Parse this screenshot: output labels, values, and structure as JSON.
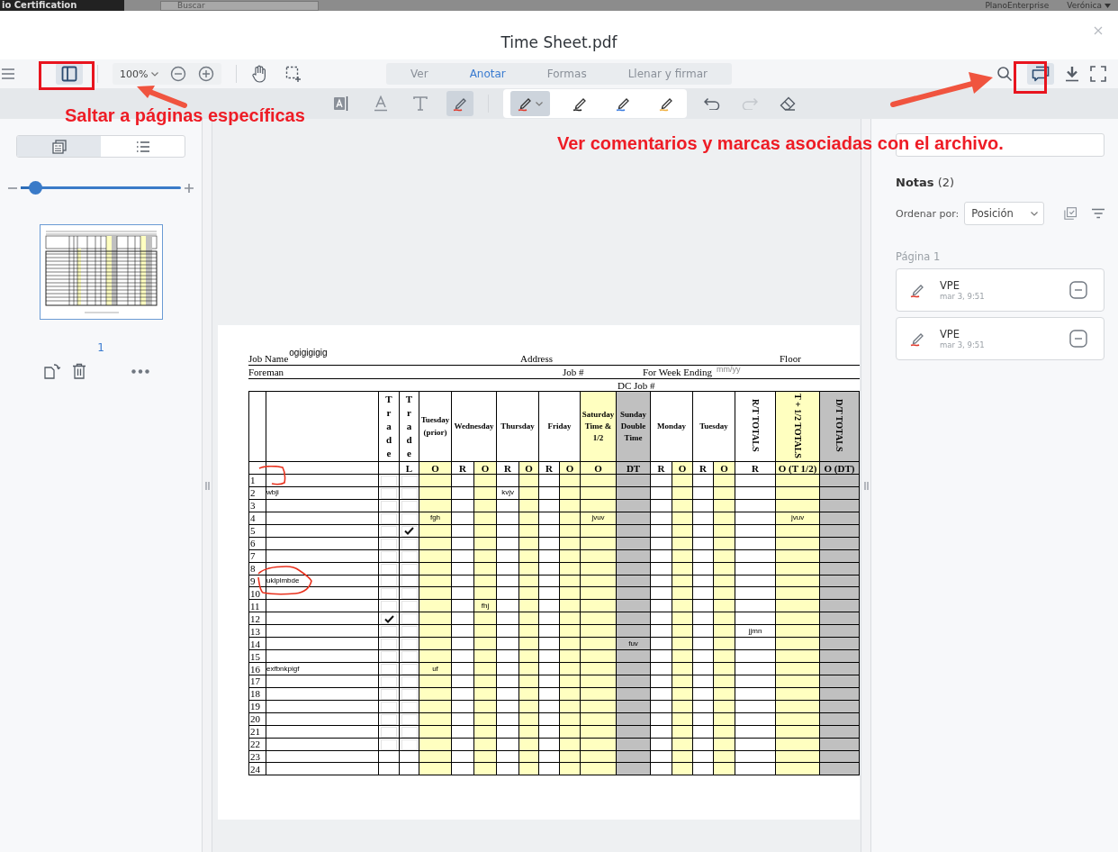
{
  "app_bar": {
    "workspace": "io Certification",
    "search_placeholder": "Buscar",
    "org": "PlanoEnterprise",
    "user": "Verónica"
  },
  "document": {
    "title": "Time Sheet.pdf"
  },
  "toolbar": {
    "panel_toggle_selected": true,
    "zoom": "100%",
    "modes": [
      {
        "label": "Ver",
        "selected": false
      },
      {
        "label": "Anotar",
        "selected": true
      },
      {
        "label": "Formas",
        "selected": false
      },
      {
        "label": "Llenar y firmar",
        "selected": false
      }
    ],
    "comments_selected": true
  },
  "annotate_tools": {
    "tools": [
      {
        "kind": "text-select",
        "selected": false
      },
      {
        "kind": "underline",
        "selected": false
      },
      {
        "kind": "text",
        "selected": false
      },
      {
        "kind": "highlight",
        "selected": true
      }
    ],
    "pens": [
      {
        "color": "#e0392b",
        "selected": true
      },
      {
        "color": "#222222",
        "selected": false
      },
      {
        "color": "#3a7be0",
        "selected": false
      },
      {
        "color": "#f0b040",
        "selected": false
      }
    ],
    "redo_disabled": true
  },
  "callouts": [
    {
      "text": "Saltar a páginas específicas"
    },
    {
      "text": "Ver comentarios y marcas asociadas con el archivo."
    }
  ],
  "left_panel": {
    "views": [
      {
        "kind": "thumbnails",
        "selected": true
      },
      {
        "kind": "outline",
        "selected": false
      }
    ],
    "thumb_size": {
      "level": 0.09
    },
    "pages": [
      {
        "number": "1",
        "selected": true
      }
    ]
  },
  "notes_panel": {
    "title": "Notas",
    "count": "(2)",
    "sort_label": "Ordenar por:",
    "sort_value": "Posición",
    "groups": [
      {
        "label": "Página 1",
        "notes": [
          {
            "author": "VPE",
            "time": "mar 3, 9:51"
          },
          {
            "author": "VPE",
            "time": "mar 3, 9:51"
          }
        ]
      }
    ]
  },
  "sheet": {
    "job_name_label": "Job Name",
    "job_name": "ogigigigig",
    "address_label": "Address",
    "floor_label": "Floor",
    "foreman_label": "Foreman",
    "job_no_label": "Job #",
    "week_ending_label": "For Week Ending",
    "week_ending_hint": "mm/yy",
    "dc_job_label": "DC Job #",
    "trade_columns": [
      {
        "label": "Trade"
      },
      {
        "label": "Trade",
        "sub": "L"
      }
    ],
    "day_columns": [
      {
        "label": "Tuesday (prior)",
        "kind": "plain",
        "color": "#ffffff",
        "subs": [
          {
            "label": "O",
            "color": "#ffffc0"
          }
        ]
      },
      {
        "label": "Wednesday",
        "kind": "plain",
        "color": "#ffffff",
        "subs": [
          {
            "label": "R",
            "color": "#ffffff"
          },
          {
            "label": "O",
            "color": "#ffffc0"
          }
        ]
      },
      {
        "label": "Thursday",
        "kind": "plain",
        "color": "#ffffff",
        "subs": [
          {
            "label": "R",
            "color": "#ffffff"
          },
          {
            "label": "O",
            "color": "#ffffc0"
          }
        ]
      },
      {
        "label": "Friday",
        "kind": "plain",
        "color": "#ffffff",
        "subs": [
          {
            "label": "R",
            "color": "#ffffff"
          },
          {
            "label": "O",
            "color": "#ffffc0"
          }
        ]
      },
      {
        "label": "Saturday Time & 1/2",
        "kind": "plain",
        "color": "#ffffc0",
        "subs": [
          {
            "label": "O",
            "color": "#ffffc0"
          }
        ]
      },
      {
        "label": "Sunday Double Time",
        "kind": "plain",
        "color": "#c0c0c0",
        "subs": [
          {
            "label": "DT",
            "color": "#c0c0c0"
          }
        ]
      },
      {
        "label": "Monday",
        "kind": "plain",
        "color": "#ffffff",
        "subs": [
          {
            "label": "R",
            "color": "#ffffff"
          },
          {
            "label": "O",
            "color": "#ffffc0"
          }
        ]
      },
      {
        "label": "Tuesday",
        "kind": "plain",
        "color": "#ffffff",
        "subs": [
          {
            "label": "R",
            "color": "#ffffff"
          },
          {
            "label": "O",
            "color": "#ffffc0"
          }
        ]
      },
      {
        "label": "R/T TOTALS",
        "kind": "rotated",
        "color": "#ffffff",
        "subs": [
          {
            "label": "R",
            "color": "#ffffff"
          }
        ]
      },
      {
        "label": "T + 1/2 TOTALS",
        "kind": "rotated",
        "color": "#ffffc0",
        "subs": [
          {
            "label": "O (T 1/2)",
            "color": "#ffffc0"
          }
        ]
      },
      {
        "label": "D/T TOTALS",
        "kind": "rotated",
        "color": "#c0c0c0",
        "subs": [
          {
            "label": "O (DT)",
            "color": "#c0c0c0"
          }
        ]
      }
    ],
    "rows": [
      {
        "number": "1",
        "trade_checks": [
          false,
          false
        ],
        "cells": [
          null,
          null,
          null,
          null,
          null,
          null,
          null,
          null,
          null,
          null,
          null,
          null,
          null,
          null,
          null,
          null
        ]
      },
      {
        "number": "2",
        "name": "wbji",
        "trade_checks": [
          false,
          false
        ],
        "cells": [
          null,
          null,
          null,
          "kvjv",
          null,
          null,
          null,
          null,
          null,
          null,
          null,
          null,
          null,
          null,
          null,
          null
        ]
      },
      {
        "number": "3",
        "trade_checks": [
          false,
          false
        ],
        "cells": [
          null,
          null,
          null,
          null,
          null,
          null,
          null,
          null,
          null,
          null,
          null,
          null,
          null,
          null,
          null,
          null
        ]
      },
      {
        "number": "4",
        "trade_checks": [
          false,
          false
        ],
        "cells": [
          "fgh",
          null,
          null,
          null,
          null,
          null,
          null,
          "jvuv",
          null,
          null,
          null,
          null,
          null,
          null,
          "jvuv",
          null
        ]
      },
      {
        "number": "5",
        "trade_checks": [
          false,
          true
        ],
        "cells": [
          null,
          null,
          null,
          null,
          null,
          null,
          null,
          null,
          null,
          null,
          null,
          null,
          null,
          null,
          null,
          null
        ]
      },
      {
        "number": "6",
        "trade_checks": [
          false,
          false
        ],
        "cells": [
          null,
          null,
          null,
          null,
          null,
          null,
          null,
          null,
          null,
          null,
          null,
          null,
          null,
          null,
          null,
          null
        ]
      },
      {
        "number": "7",
        "trade_checks": [
          false,
          false
        ],
        "cells": [
          null,
          null,
          null,
          null,
          null,
          null,
          null,
          null,
          null,
          null,
          null,
          null,
          null,
          null,
          null,
          null
        ]
      },
      {
        "number": "8",
        "trade_checks": [
          false,
          false
        ],
        "cells": [
          null,
          null,
          null,
          null,
          null,
          null,
          null,
          null,
          null,
          null,
          null,
          null,
          null,
          null,
          null,
          null
        ]
      },
      {
        "number": "9",
        "name": "uklplmbde",
        "trade_checks": [
          false,
          false
        ],
        "cells": [
          null,
          null,
          null,
          null,
          null,
          null,
          null,
          null,
          null,
          null,
          null,
          null,
          null,
          null,
          null,
          null
        ]
      },
      {
        "number": "10",
        "trade_checks": [
          false,
          false
        ],
        "cells": [
          null,
          null,
          null,
          null,
          null,
          null,
          null,
          null,
          null,
          null,
          null,
          null,
          null,
          null,
          null,
          null
        ]
      },
      {
        "number": "11",
        "trade_checks": [
          false,
          false
        ],
        "cells": [
          null,
          null,
          "fhj",
          null,
          null,
          null,
          null,
          null,
          null,
          null,
          null,
          null,
          null,
          null,
          null,
          null
        ]
      },
      {
        "number": "12",
        "trade_checks": [
          true,
          false
        ],
        "cells": [
          null,
          null,
          null,
          null,
          null,
          null,
          null,
          null,
          null,
          null,
          null,
          null,
          null,
          null,
          null,
          null
        ]
      },
      {
        "number": "13",
        "trade_checks": [
          false,
          false
        ],
        "cells": [
          null,
          null,
          null,
          null,
          null,
          null,
          null,
          null,
          null,
          null,
          null,
          null,
          null,
          "jjmn",
          null,
          null
        ]
      },
      {
        "number": "14",
        "trade_checks": [
          false,
          false
        ],
        "cells": [
          null,
          null,
          null,
          null,
          null,
          null,
          null,
          null,
          "fuv",
          null,
          null,
          null,
          null,
          null,
          null,
          null
        ]
      },
      {
        "number": "15",
        "trade_checks": [
          false,
          false
        ],
        "cells": [
          null,
          null,
          null,
          null,
          null,
          null,
          null,
          null,
          null,
          null,
          null,
          null,
          null,
          null,
          null,
          null
        ]
      },
      {
        "number": "16",
        "name": "exfbnkpigf",
        "trade_checks": [
          false,
          false
        ],
        "cells": [
          "uf",
          null,
          null,
          null,
          null,
          null,
          null,
          null,
          null,
          null,
          null,
          null,
          null,
          null,
          null,
          null
        ]
      },
      {
        "number": "17",
        "trade_checks": [
          false,
          false
        ],
        "cells": [
          null,
          null,
          null,
          null,
          null,
          null,
          null,
          null,
          null,
          null,
          null,
          null,
          null,
          null,
          null,
          null
        ]
      },
      {
        "number": "18",
        "trade_checks": [
          false,
          false
        ],
        "cells": [
          null,
          null,
          null,
          null,
          null,
          null,
          null,
          null,
          null,
          null,
          null,
          null,
          null,
          null,
          null,
          null
        ]
      },
      {
        "number": "19",
        "trade_checks": [
          false,
          false
        ],
        "cells": [
          null,
          null,
          null,
          null,
          null,
          null,
          null,
          null,
          null,
          null,
          null,
          null,
          null,
          null,
          null,
          null
        ]
      },
      {
        "number": "20",
        "trade_checks": [
          false,
          false
        ],
        "cells": [
          null,
          null,
          null,
          null,
          null,
          null,
          null,
          null,
          null,
          null,
          null,
          null,
          null,
          null,
          null,
          null
        ]
      },
      {
        "number": "21",
        "trade_checks": [
          false,
          false
        ],
        "cells": [
          null,
          null,
          null,
          null,
          null,
          null,
          null,
          null,
          null,
          null,
          null,
          null,
          null,
          null,
          null,
          null
        ]
      },
      {
        "number": "22",
        "trade_checks": [
          false,
          false
        ],
        "cells": [
          null,
          null,
          null,
          null,
          null,
          null,
          null,
          null,
          null,
          null,
          null,
          null,
          null,
          null,
          null,
          null
        ]
      },
      {
        "number": "23",
        "cells": [
          null,
          null,
          null,
          null,
          null,
          null,
          null,
          null,
          null,
          null,
          null,
          null,
          null,
          null,
          null,
          null
        ]
      },
      {
        "number": "24",
        "cells": [
          null,
          null,
          null,
          null,
          null,
          null,
          null,
          null,
          null,
          null,
          null,
          null,
          null,
          null,
          null,
          null
        ]
      }
    ]
  }
}
